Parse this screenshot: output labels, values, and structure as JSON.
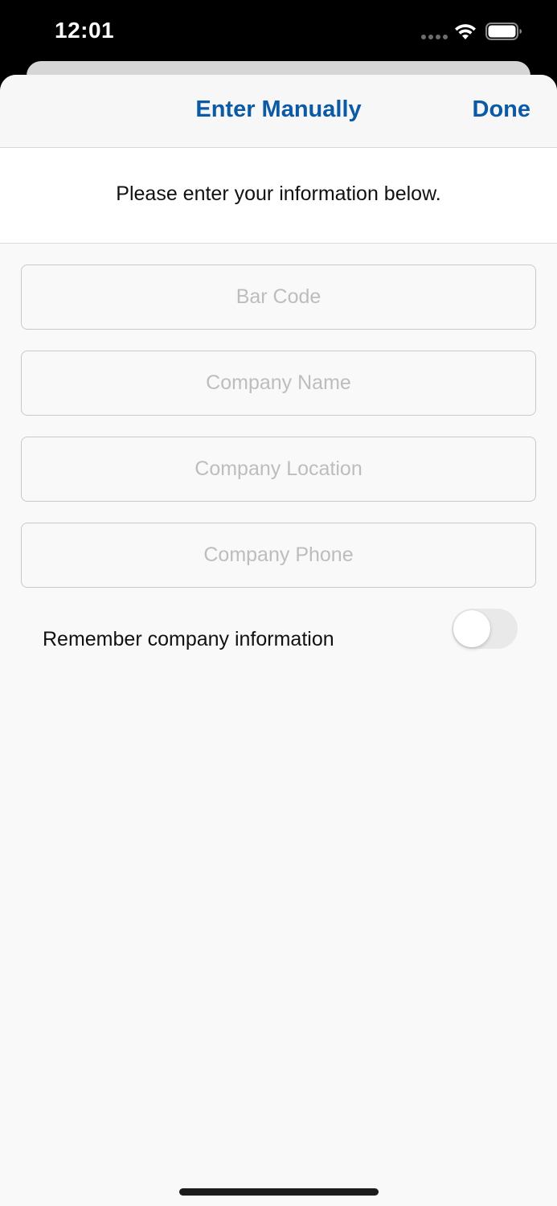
{
  "status_bar": {
    "time": "12:01",
    "icons": [
      "cellular-signal-icon",
      "wifi-icon",
      "battery-icon"
    ]
  },
  "nav": {
    "title": "Enter Manually",
    "done_label": "Done"
  },
  "intro": {
    "text": "Please enter your information below."
  },
  "form": {
    "fields": [
      {
        "placeholder": "Bar Code",
        "value": ""
      },
      {
        "placeholder": "Company Name",
        "value": ""
      },
      {
        "placeholder": "Company Location",
        "value": ""
      },
      {
        "placeholder": "Company Phone",
        "value": ""
      }
    ],
    "remember": {
      "label": "Remember company information",
      "enabled": false
    }
  },
  "colors": {
    "accent": "#0b5aa6",
    "background": "#f9f9f9",
    "toggle_off": "#e9e9ea"
  }
}
